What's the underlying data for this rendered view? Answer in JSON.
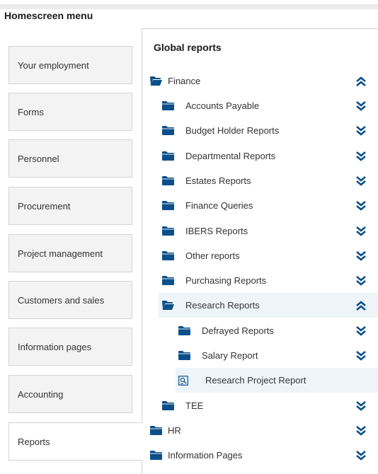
{
  "header": {
    "title": "Homescreen menu"
  },
  "menu": {
    "items": [
      {
        "label": "Your employment"
      },
      {
        "label": "Forms"
      },
      {
        "label": "Personnel"
      },
      {
        "label": "Procurement"
      },
      {
        "label": "Project management"
      },
      {
        "label": "Customers and sales"
      },
      {
        "label": "Information pages"
      },
      {
        "label": "Accounting"
      },
      {
        "label": "Reports",
        "active": true
      }
    ]
  },
  "panel": {
    "title": "Global reports",
    "tree": [
      {
        "label": "Finance",
        "level": 0,
        "expanded": true,
        "icon": "folder-open-icon"
      },
      {
        "label": "Accounts Payable",
        "level": 1,
        "expanded": false,
        "icon": "folder-icon"
      },
      {
        "label": "Budget Holder Reports",
        "level": 1,
        "expanded": false,
        "icon": "folder-icon"
      },
      {
        "label": "Departmental Reports",
        "level": 1,
        "expanded": false,
        "icon": "folder-icon"
      },
      {
        "label": "Estates Reports",
        "level": 1,
        "expanded": false,
        "icon": "folder-icon"
      },
      {
        "label": "Finance Queries",
        "level": 1,
        "expanded": false,
        "icon": "folder-icon"
      },
      {
        "label": "IBERS Reports",
        "level": 1,
        "expanded": false,
        "icon": "folder-icon"
      },
      {
        "label": "Other reports",
        "level": 1,
        "expanded": false,
        "icon": "folder-icon"
      },
      {
        "label": "Purchasing Reports",
        "level": 1,
        "expanded": false,
        "icon": "folder-icon"
      },
      {
        "label": "Research Reports",
        "level": 1,
        "expanded": true,
        "icon": "folder-open-icon",
        "highlighted": true
      },
      {
        "label": "Defrayed Reports",
        "level": 2,
        "expanded": false,
        "icon": "folder-icon"
      },
      {
        "label": "Salary Report",
        "level": 2,
        "expanded": false,
        "icon": "folder-icon"
      },
      {
        "label": "Research Project Report",
        "level": 2,
        "icon": "report-icon",
        "highlighted": true,
        "leaf": true
      },
      {
        "label": "TEE",
        "level": 1,
        "expanded": false,
        "icon": "folder-icon"
      },
      {
        "label": "HR",
        "level": 0,
        "expanded": false,
        "icon": "folder-icon"
      },
      {
        "label": "Information Pages",
        "level": 0,
        "expanded": false,
        "icon": "folder-icon"
      }
    ]
  },
  "colors": {
    "accent": "#0b4f8a",
    "highlight": "#eef5f9",
    "menu_bg": "#f3f3f3"
  }
}
